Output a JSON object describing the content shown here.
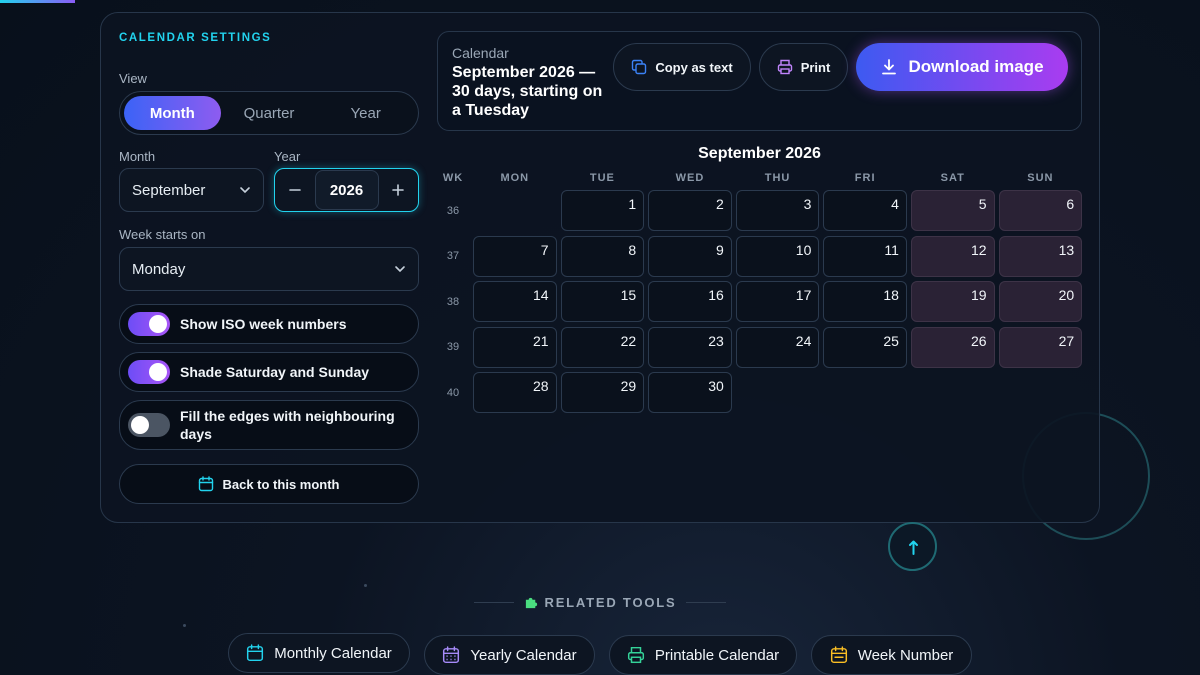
{
  "settings": {
    "section_title": "CALENDAR SETTINGS",
    "view_label": "View",
    "view_options": [
      "Month",
      "Quarter",
      "Year"
    ],
    "view_selected": "Month",
    "month_label": "Month",
    "month_value": "September",
    "year_label": "Year",
    "year_value": "2026",
    "week_start_label": "Week starts on",
    "week_start_value": "Monday",
    "toggles": [
      {
        "label": "Show ISO week numbers",
        "on": true
      },
      {
        "label": "Shade Saturday and Sunday",
        "on": true
      },
      {
        "label": "Fill the edges with neighbouring days",
        "on": false
      }
    ],
    "back_button": "Back to this month"
  },
  "header": {
    "kicker": "Calendar",
    "title": "September 2026 — 30 days, starting on a Tuesday",
    "copy_button": "Copy as text",
    "print_button": "Print",
    "download_button": "Download image"
  },
  "calendar": {
    "heading": "September 2026",
    "wk_header": "WK",
    "weekdays": [
      "MON",
      "TUE",
      "WED",
      "THU",
      "FRI",
      "SAT",
      "SUN"
    ],
    "weeks": [
      {
        "wk": "36",
        "days": [
          "",
          "1",
          "2",
          "3",
          "4",
          "5",
          "6"
        ]
      },
      {
        "wk": "37",
        "days": [
          "7",
          "8",
          "9",
          "10",
          "11",
          "12",
          "13"
        ]
      },
      {
        "wk": "38",
        "days": [
          "14",
          "15",
          "16",
          "17",
          "18",
          "19",
          "20"
        ]
      },
      {
        "wk": "39",
        "days": [
          "21",
          "22",
          "23",
          "24",
          "25",
          "26",
          "27"
        ]
      },
      {
        "wk": "40",
        "days": [
          "28",
          "29",
          "30",
          "",
          "",
          "",
          ""
        ]
      }
    ]
  },
  "related": {
    "title": "RELATED TOOLS",
    "tools": [
      "Monthly Calendar",
      "Yearly Calendar",
      "Printable Calendar",
      "Week Number"
    ]
  },
  "colors": {
    "accent_cyan": "#22d3ee",
    "accent_purple": "#a855f7",
    "accent_blue": "#3b63f6",
    "weekend_shade": "#2a2235"
  }
}
